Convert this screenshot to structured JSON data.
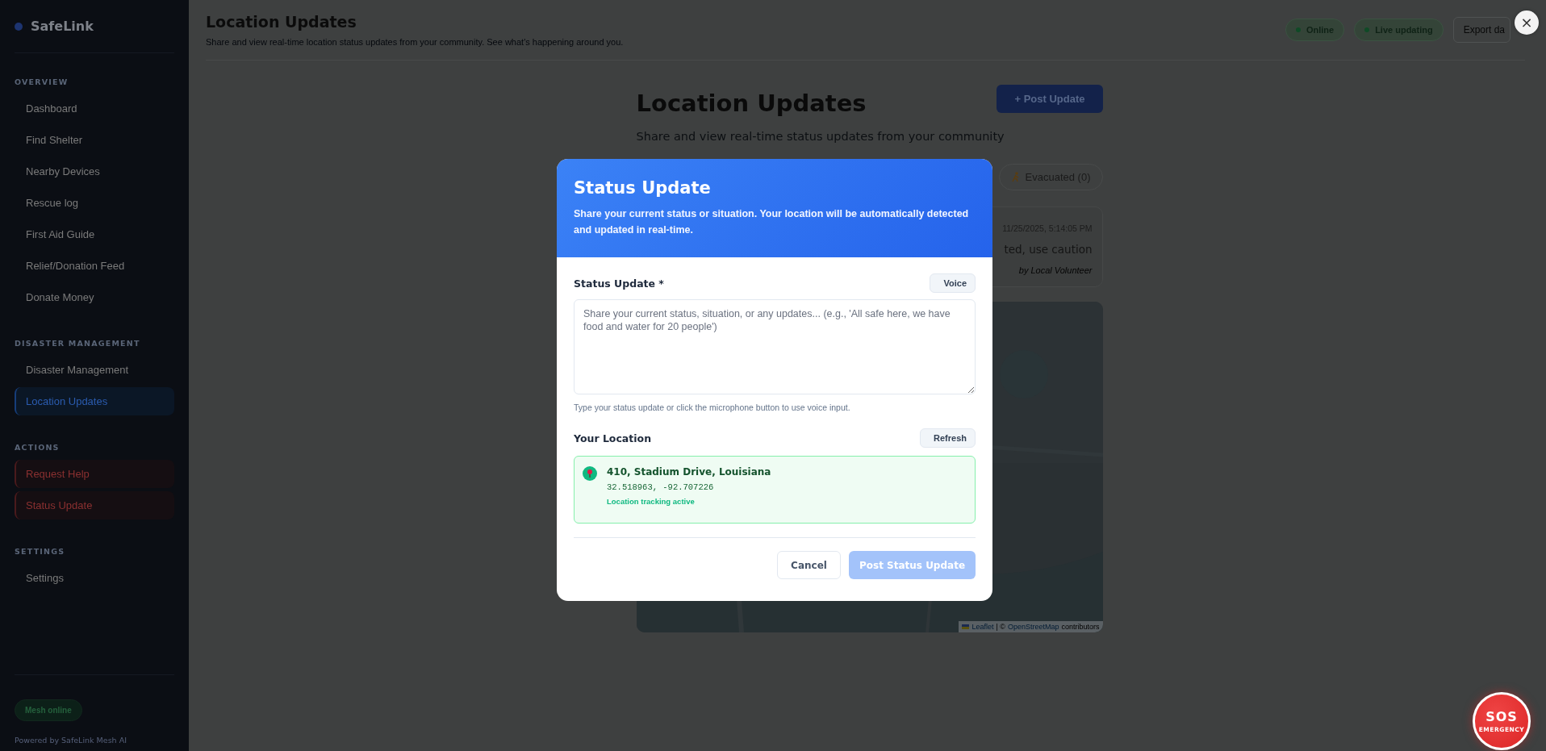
{
  "sidebar": {
    "logo": "SafeLink",
    "sections": [
      {
        "title": "OVERVIEW",
        "items": [
          {
            "label": "Dashboard",
            "kind": "nav",
            "selected": false
          },
          {
            "label": "Find Shelter",
            "kind": "nav",
            "selected": false
          },
          {
            "label": "Nearby Devices",
            "kind": "nav",
            "selected": false
          },
          {
            "label": "Rescue log",
            "kind": "nav",
            "selected": false
          },
          {
            "label": "First Aid Guide",
            "kind": "nav",
            "selected": false
          },
          {
            "label": "Relief/Donation Feed",
            "kind": "nav",
            "selected": false
          },
          {
            "label": "Donate Money",
            "kind": "nav",
            "selected": false
          }
        ]
      },
      {
        "title": "DISASTER MANAGEMENT",
        "items": [
          {
            "label": "Disaster Management",
            "kind": "nav",
            "selected": false
          },
          {
            "label": "Location Updates",
            "kind": "nav",
            "selected": true
          }
        ]
      },
      {
        "title": "ACTIONS",
        "items": [
          {
            "label": "Request Help",
            "kind": "action",
            "selected": false
          },
          {
            "label": "Status Update",
            "kind": "action",
            "selected": false
          }
        ]
      },
      {
        "title": "SETTINGS",
        "items": [
          {
            "label": "Settings",
            "kind": "nav",
            "selected": false
          }
        ]
      }
    ],
    "mesh_status": "Mesh online",
    "footer": "Powered by SafeLink Mesh AI"
  },
  "header": {
    "title": "Location Updates",
    "subtitle": "Share and view real-time location status updates from your community. See what's happening around you.",
    "badges": [
      {
        "label": "Online"
      },
      {
        "label": "Live updating"
      }
    ],
    "export_button": "Export da"
  },
  "main": {
    "title": "Location Updates",
    "post_button": "+ Post Update",
    "subtitle": "Share and view real-time status updates from your community",
    "filter_tabs": [
      {
        "label": "Evacuated (0)",
        "selected": false
      }
    ],
    "update_card": {
      "timestamp": "11/25/2025, 5:14:05 PM",
      "message": "ted, use caution",
      "author": "by Local Volunteer"
    },
    "map": {
      "kind": "picture",
      "attribution": {
        "leaflet": "Leaflet",
        "separator": "| ©",
        "osm": "OpenStreetMap",
        "suffix": "contributors"
      }
    }
  },
  "modal": {
    "title": "Status Update",
    "description": "Share your current status or situation. Your location will be automatically detected and updated in real-time.",
    "status_label": "Status Update *",
    "voice_button": "Voice",
    "placeholder": "Share your current status, situation, or any updates... (e.g., 'All safe here, we have food and water for 20 people')",
    "helper": "Type your status update or click the microphone button to use voice input.",
    "location_label": "Your Location",
    "refresh_button": "Refresh",
    "location": {
      "address": "410, Stadium Drive, Louisiana",
      "coordinates": "32.518963, -92.707226",
      "tracking": "Location tracking active"
    },
    "cancel_button": "Cancel",
    "submit_button": {
      "label": "Post Status Update",
      "disabled": true
    }
  },
  "close_button": "×",
  "sos_button": {
    "title": "SOS",
    "subtitle": "EMERGENCY"
  }
}
